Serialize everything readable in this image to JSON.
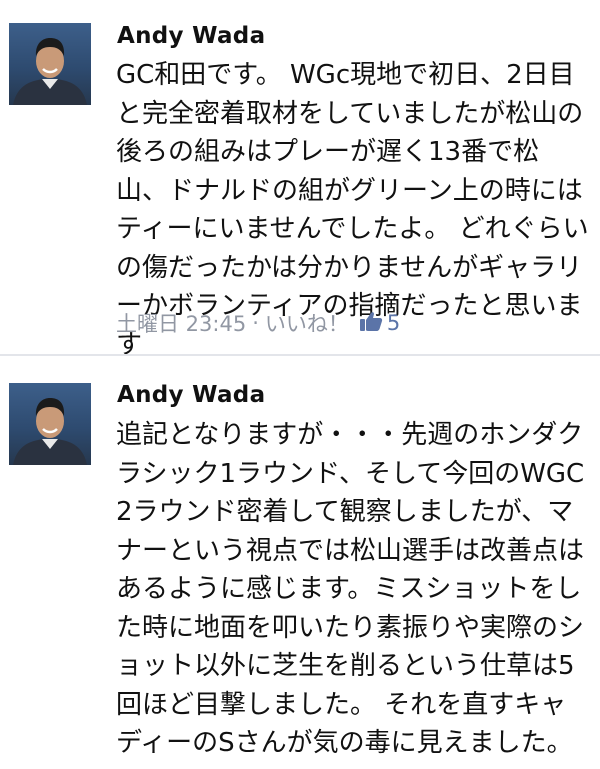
{
  "comments": [
    {
      "author": "Andy Wada",
      "text": "GC和田です。 WGc現地で初日、2日目と完全密着取材をしていましたが松山の後ろの組みはプレーが遅く13番で松山、ドナルドの組がグリーン上の時にはティーにいませんでしたよ。 どれぐらいの傷だったかは分かりませんがギャラリーかボランティアの指摘だったと思います",
      "timestamp": "土曜日 23:45",
      "separator": "·",
      "like_label": "いいね！",
      "like_icon": "thumbs-up-icon",
      "like_count": "5"
    },
    {
      "author": "Andy Wada",
      "text": "追記となりますが・・・先週のホンダクラシック1ラウンド、そして今回のWGC2ラウンド密着して観察しましたが、マナーという視点では松山選手は改善点はあるように感じます。ミスショットをした時に地面を叩いたり素振りや実際のショット以外に芝生を削るという仕草は5回ほど目撃しました。 それを直すキャディーのSさんが気の毒に見えました。"
    }
  ],
  "colors": {
    "meta_text": "#9197a3",
    "like_accent": "#5b74a8",
    "divider": "#e3e5ea"
  }
}
